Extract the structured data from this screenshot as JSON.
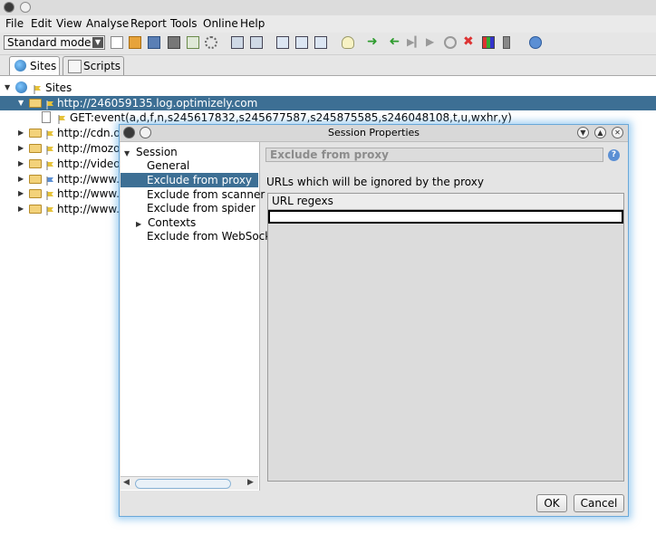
{
  "menu": [
    "File",
    "Edit",
    "View",
    "Analyse",
    "Report",
    "Tools",
    "Online",
    "Help"
  ],
  "toolbar": {
    "mode_label": "Standard mode",
    "icons": [
      "new-session-icon",
      "open-session-icon",
      "save-session-icon",
      "snapshot-icon",
      "session-properties-icon",
      "options-gear-icon",
      "layout-full-icon",
      "layout-tabs-icon",
      "layout-side-icon",
      "layout-below-icon",
      "layout-tabbed-icon",
      "lightbulb-icon",
      "step-forward-icon",
      "step-back-icon",
      "continue-icon",
      "play-icon",
      "stop-icon",
      "delete-breakpoint-icon",
      "add-ons-icon",
      "scan-policy-icon",
      "help-icon"
    ]
  },
  "tabs": {
    "sites": "Sites",
    "scripts": "Scripts"
  },
  "tree": {
    "root": "Sites",
    "selected_host": "http://246059135.log.optimizely.com",
    "child_request": "GET:event(a,d,f,n,s245617832,s245677587,s245875585,s246048108,t,u,wxhr,y)",
    "hosts": [
      "http://cdn.o",
      "http://mozor",
      "http://videos",
      "http://www.g",
      "http://www.n",
      "http://www.n"
    ]
  },
  "dialog": {
    "title": "Session Properties",
    "tree": {
      "session": "Session",
      "general": "General",
      "exclude_proxy": "Exclude from proxy",
      "exclude_scanner": "Exclude from scanner",
      "exclude_spider": "Exclude from spider",
      "contexts": "Contexts",
      "exclude_websocket": "Exclude from WebSock"
    },
    "panel_title": "Exclude from proxy",
    "panel_description": "URLs which will be ignored by the proxy",
    "table_header": "URL regexs",
    "ok": "OK",
    "cancel": "Cancel"
  },
  "colors": {
    "selection": "#3d6f94",
    "dialog_glow": "#6aa8d8"
  }
}
